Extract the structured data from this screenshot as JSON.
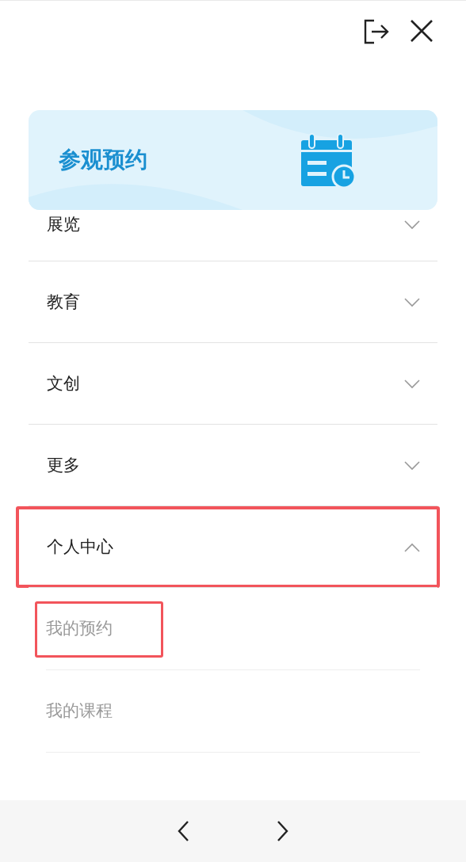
{
  "banner": {
    "title": "参观预约"
  },
  "menu": [
    {
      "label": "展览",
      "expanded": false,
      "highlighted": false
    },
    {
      "label": "教育",
      "expanded": false,
      "highlighted": false
    },
    {
      "label": "文创",
      "expanded": false,
      "highlighted": false
    },
    {
      "label": "更多",
      "expanded": false,
      "highlighted": false
    },
    {
      "label": "个人中心",
      "expanded": true,
      "highlighted": true,
      "children": [
        {
          "label": "我的预约",
          "highlighted": true
        },
        {
          "label": "我的课程",
          "highlighted": false
        }
      ]
    }
  ]
}
